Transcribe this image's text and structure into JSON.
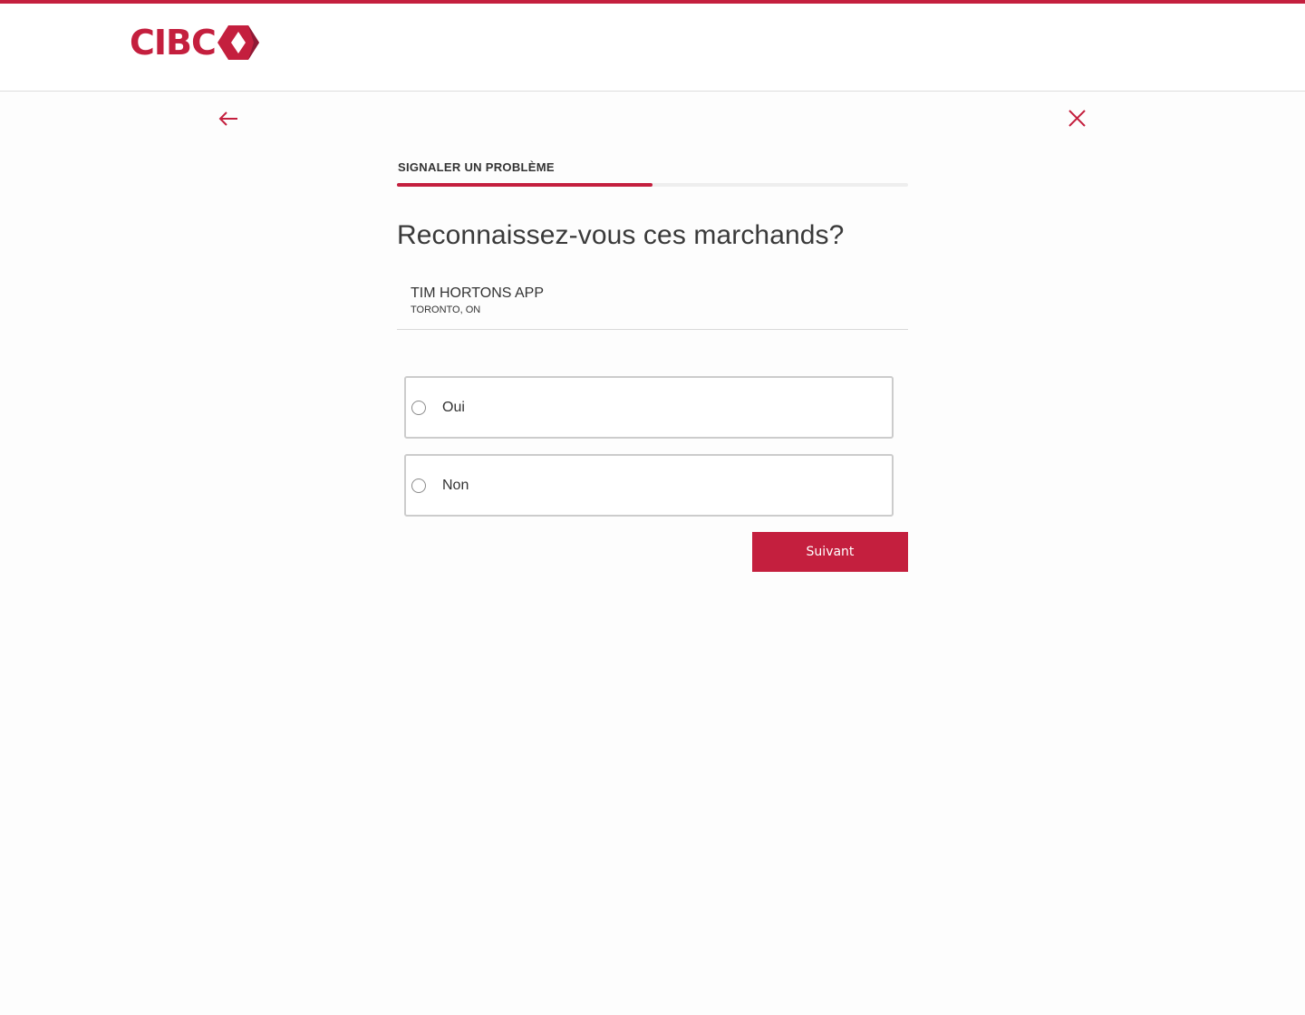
{
  "brand": {
    "name": "CIBC",
    "accent_color": "#c41f3e",
    "logo_icon": "cibc-diamond-icon"
  },
  "nav": {
    "back_icon": "arrow-left-icon",
    "close_icon": "close-icon"
  },
  "step": {
    "title": "SIGNALER UN PROBLÈME",
    "progress_fraction": 0.5
  },
  "question": "Reconnaissez-vous ces marchands?",
  "merchant": {
    "name": "TIM HORTONS APP",
    "location": "TORONTO, ON"
  },
  "options": [
    {
      "label": "Oui",
      "selected": false
    },
    {
      "label": "Non",
      "selected": false
    }
  ],
  "actions": {
    "next_label": "Suivant"
  }
}
